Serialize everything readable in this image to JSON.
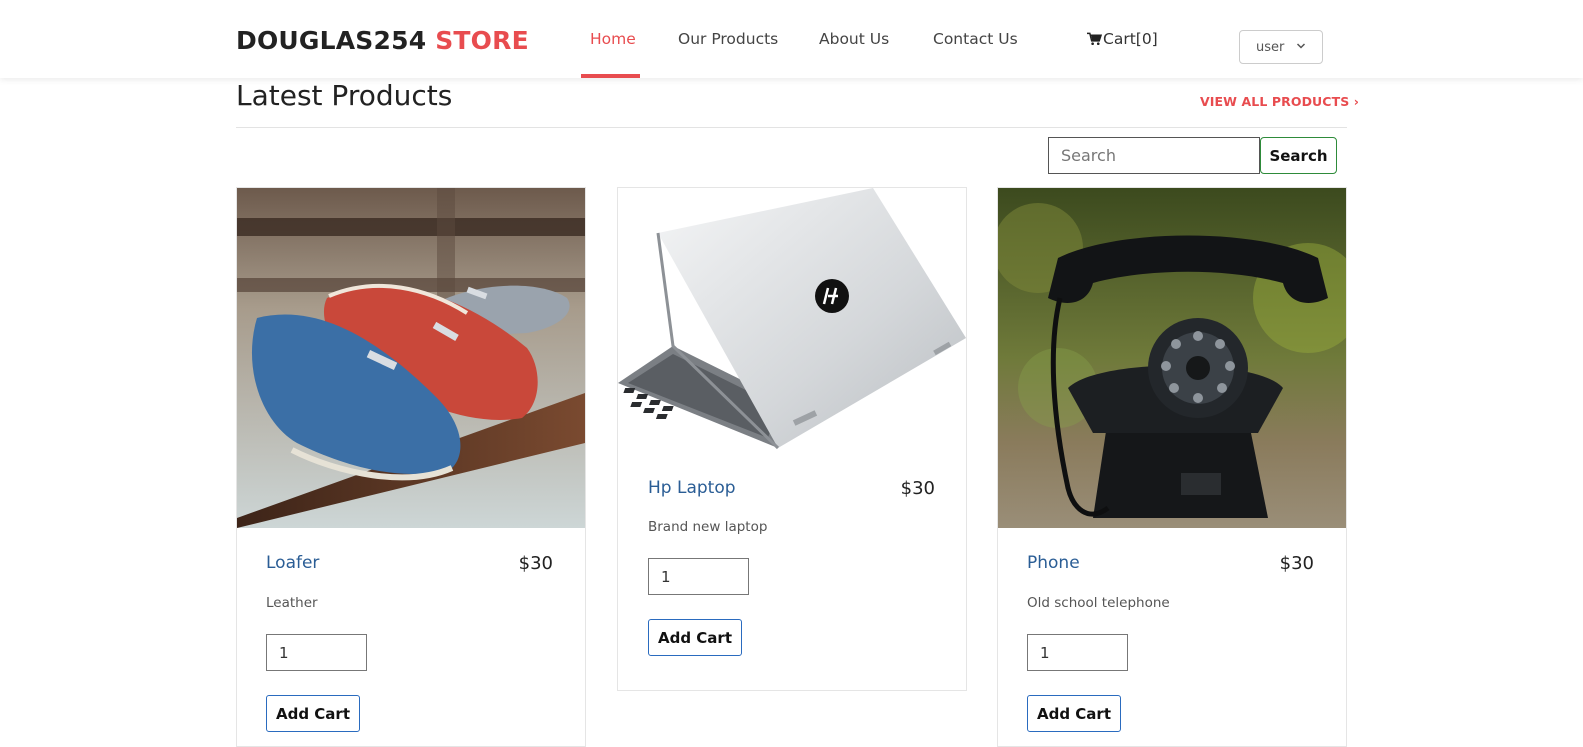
{
  "header": {
    "brand_main": "DOUGLAS254",
    "brand_accent": "STORE",
    "nav": [
      "Home",
      "Our Products",
      "About Us",
      "Contact Us"
    ],
    "active_nav": "Home",
    "cart_label": "Cart[0]",
    "user_select": "user"
  },
  "section": {
    "title": "Latest Products",
    "view_all": "VIEW ALL PRODUCTS ›"
  },
  "search": {
    "placeholder": "Search",
    "button": "Search"
  },
  "products": [
    {
      "name": "Loafer",
      "price": "$30",
      "description": "Leather",
      "qty": "1",
      "button": "Add Cart"
    },
    {
      "name": "Hp Laptop",
      "price": "$30",
      "description": "Brand new laptop",
      "qty": "1",
      "button": "Add Cart"
    },
    {
      "name": "Phone",
      "price": "$30",
      "description": "Old school telephone",
      "qty": "1",
      "button": "Add Cart"
    }
  ],
  "colors": {
    "accent": "#e84c4f",
    "link": "#2a5d95",
    "button_border": "#2a6bbf",
    "search_border": "#2e8b3a"
  }
}
